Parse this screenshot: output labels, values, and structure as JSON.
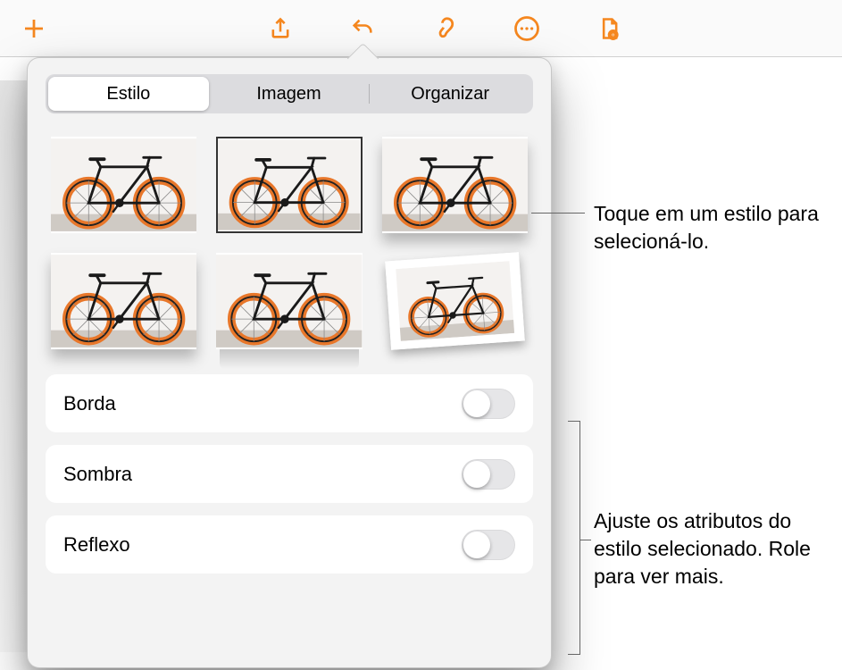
{
  "toolbar": {
    "add": "add",
    "share": "share",
    "undo": "undo",
    "format": "format",
    "more": "more",
    "document": "document"
  },
  "popover": {
    "tabs": {
      "style": "Estilo",
      "image": "Imagem",
      "arrange": "Organizar"
    },
    "attributes": {
      "border": "Borda",
      "shadow": "Sombra",
      "reflection": "Reflexo"
    }
  },
  "callouts": {
    "styles": "Toque em um estilo para selecioná-lo.",
    "attributes": "Ajuste os atributos do estilo selecionado. Role para ver mais."
  }
}
